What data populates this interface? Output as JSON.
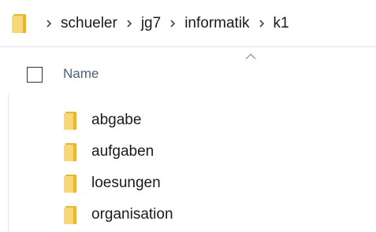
{
  "breadcrumb": {
    "icon": "folder-icon",
    "separator_icon": "chevron-right-icon",
    "items": [
      "schueler",
      "jg7",
      "informatik",
      "k1"
    ]
  },
  "column_header": {
    "sort_icon": "sort-ascending-caret-icon",
    "name_label": "Name"
  },
  "files": [
    {
      "name": "abgabe",
      "icon": "folder-icon"
    },
    {
      "name": "aufgaben",
      "icon": "folder-icon"
    },
    {
      "name": "loesungen",
      "icon": "folder-icon"
    },
    {
      "name": "organisation",
      "icon": "folder-icon"
    }
  ],
  "colors": {
    "folder_yellow": "#f8d775",
    "folder_dark": "#e8b730",
    "header_text": "#4c607a"
  }
}
